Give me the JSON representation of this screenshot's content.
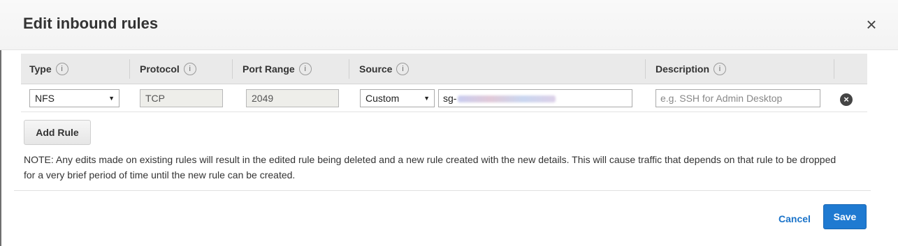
{
  "modal": {
    "title": "Edit inbound rules"
  },
  "table": {
    "headers": [
      {
        "label": "Type",
        "info": "i"
      },
      {
        "label": "Protocol",
        "info": "i"
      },
      {
        "label": "Port Range",
        "info": "i"
      },
      {
        "label": "Source",
        "info": "i"
      },
      {
        "label": "Description",
        "info": "i"
      }
    ],
    "rows": [
      {
        "type": "NFS",
        "protocol": "TCP",
        "port_range": "2049",
        "source_mode": "Custom",
        "source_value_prefix": "sg-",
        "description_placeholder": "e.g. SSH for Admin Desktop"
      }
    ]
  },
  "actions": {
    "add_rule": "Add Rule",
    "cancel": "Cancel",
    "save": "Save"
  },
  "note": "NOTE: Any edits made on existing rules will result in the edited rule being deleted and a new rule created with the new details. This will cause traffic that depends on that rule to be dropped for a very brief period of time until the new rule can be created.",
  "icons": {
    "close": "close-icon",
    "remove": "remove-circle-icon",
    "info": "info-icon",
    "caret": "caret-down-icon"
  },
  "colors": {
    "primary": "#1f7ad1",
    "link": "#1a73c9"
  }
}
